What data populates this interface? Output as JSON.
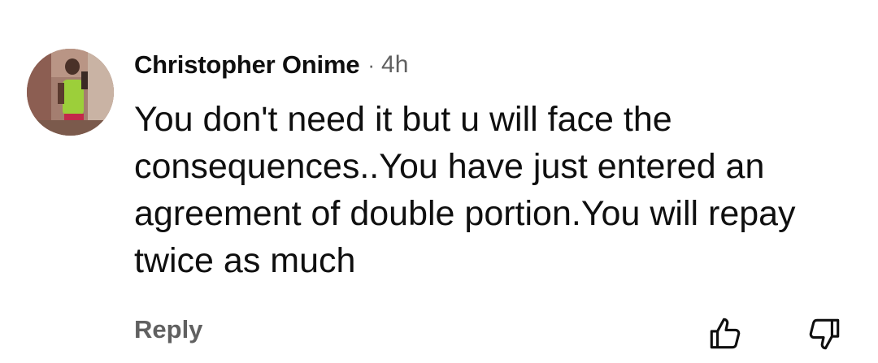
{
  "comment": {
    "author": "Christopher Onime",
    "separator": "·",
    "time": "4h",
    "text": "You don't need it but u will face the consequences..You have just entered an agreement of double portion.You will repay twice as much",
    "avatar_icon": "user-avatar-photo"
  },
  "actions": {
    "reply_label": "Reply",
    "like_icon": "thumbs-up-icon",
    "dislike_icon": "thumbs-down-icon"
  },
  "colors": {
    "primary_text": "#0f0f0f",
    "secondary_text": "#606060",
    "background": "#ffffff"
  }
}
